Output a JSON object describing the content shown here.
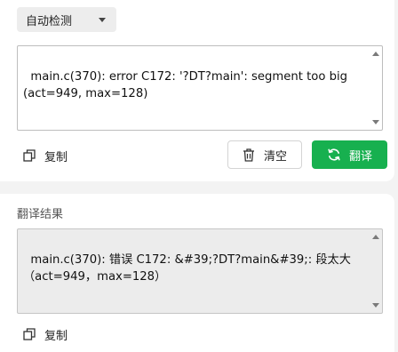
{
  "source": {
    "language_select": "自动检测",
    "text": "main.c(370): error C172: '?DT?main': segment too big\n(act=949, max=128)"
  },
  "actions": {
    "copy_label": "复制",
    "clear_label": "清空",
    "translate_label": "翻译"
  },
  "result": {
    "title": "翻译结果",
    "text": "main.c(370): 错误 C172: &#39;?DT?main&#39;: 段太大\n（act=949，max=128）",
    "copy_label": "复制"
  },
  "colors": {
    "accent": "#17b04f",
    "background": "#f3f3f3"
  },
  "icons": {
    "copy": "copy-icon",
    "trash": "trash-icon",
    "refresh": "refresh-icon",
    "caret": "caret-down-icon"
  }
}
